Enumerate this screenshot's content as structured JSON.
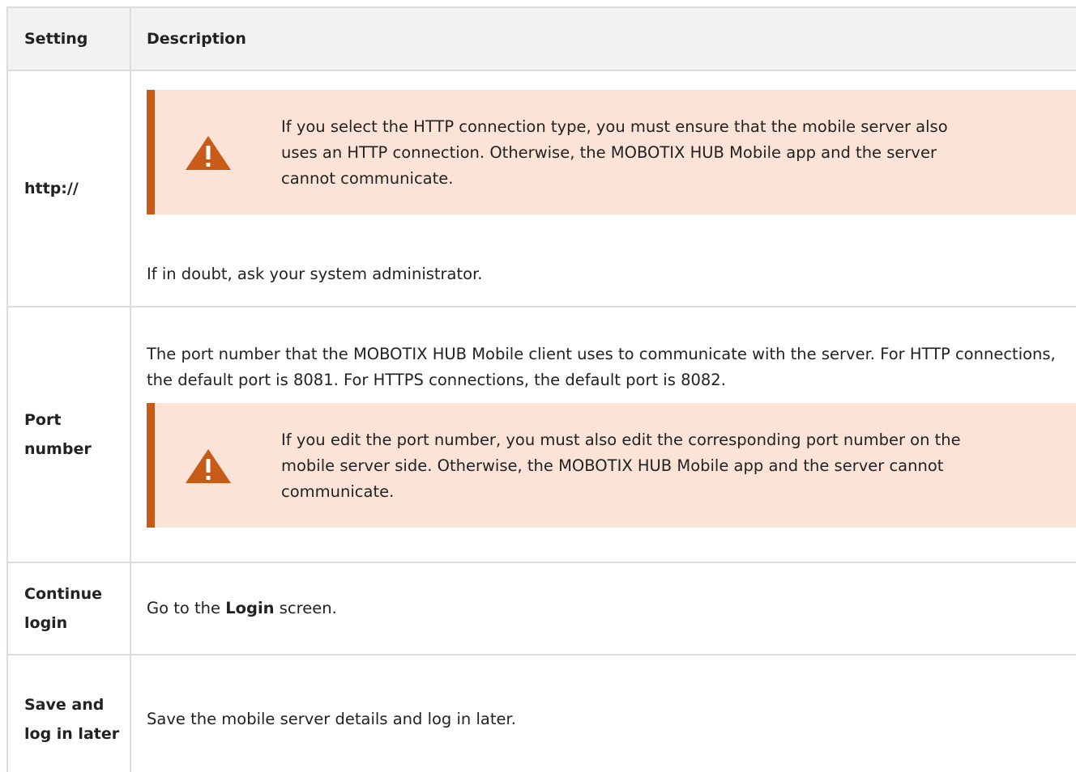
{
  "table": {
    "headers": {
      "setting": "Setting",
      "description": "Description"
    },
    "rows": [
      {
        "setting": "http://",
        "warning": "If you select the HTTP connection type, you must ensure that the mobile server also uses an HTTP connection. Otherwise, the MOBOTIX HUB Mobile app and the server cannot communicate.",
        "note": "If in doubt, ask your system administrator."
      },
      {
        "setting": "Port number",
        "description": "The port number that the MOBOTIX HUB Mobile client uses to communicate with the server. For HTTP connections, the default port is 8081. For HTTPS connections, the default port is 8082.",
        "warning": "If you edit the port number, you must also edit the corresponding port number on the mobile server side. Otherwise, the MOBOTIX HUB Mobile app and the server cannot communicate."
      },
      {
        "setting": "Continue login",
        "description_prefix": "Go to the ",
        "description_bold": "Login",
        "description_suffix": " screen."
      },
      {
        "setting": "Save and log in later",
        "description": "Save the mobile server details and log in later."
      }
    ]
  },
  "icons": {
    "warning": "warning-triangle-icon",
    "warning_color": "#c95b18",
    "warning_bg": "#fbe4d7"
  }
}
